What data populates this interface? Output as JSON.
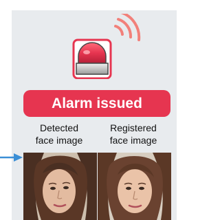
{
  "alarm": {
    "badge_label": "Alarm issued",
    "badge_color": "#e63550",
    "icon": "alarm-siren-icon",
    "signal_icon": "signal-waves-icon"
  },
  "faces": {
    "detected": {
      "caption_line1": "Detected",
      "caption_line2": "face image",
      "image": "detected-face-photo"
    },
    "registered": {
      "caption_line1": "Registered",
      "caption_line2": "face image",
      "image": "registered-face-photo"
    }
  },
  "arrow": {
    "icon": "right-arrow-icon",
    "color": "#3b8fd6"
  },
  "colors": {
    "panel_background": "#e8ebee",
    "siren_red": "#e63550",
    "wave_pink": "#f2807a"
  }
}
